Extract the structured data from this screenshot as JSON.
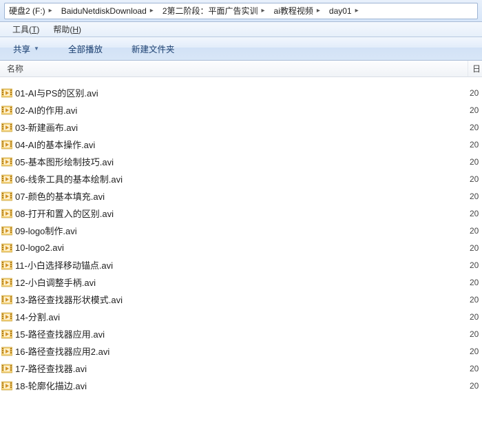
{
  "breadcrumb": [
    {
      "label": "硬盘2 (F:)"
    },
    {
      "label": "BaiduNetdiskDownload"
    },
    {
      "label": "2第二阶段：平面广告实训"
    },
    {
      "label": "ai教程视频"
    },
    {
      "label": "day01"
    }
  ],
  "menubar": {
    "tools": "工具",
    "tools_key": "T",
    "help": "帮助",
    "help_key": "H"
  },
  "cmdbar": {
    "share": "共享",
    "play_all": "全部播放",
    "new_folder": "新建文件夹"
  },
  "columns": {
    "name": "名称",
    "date": "日"
  },
  "files": [
    {
      "name": "01-AI与PS的区别.avi",
      "date": "20"
    },
    {
      "name": "02-AI的作用.avi",
      "date": "20"
    },
    {
      "name": "03-新建画布.avi",
      "date": "20"
    },
    {
      "name": "04-AI的基本操作.avi",
      "date": "20"
    },
    {
      "name": "05-基本图形绘制技巧.avi",
      "date": "20"
    },
    {
      "name": "06-线条工具的基本绘制.avi",
      "date": "20"
    },
    {
      "name": "07-颜色的基本填充.avi",
      "date": "20"
    },
    {
      "name": "08-打开和置入的区别.avi",
      "date": "20"
    },
    {
      "name": "09-logo制作.avi",
      "date": "20"
    },
    {
      "name": "10-logo2.avi",
      "date": "20"
    },
    {
      "name": "11-小白选择移动锚点.avi",
      "date": "20"
    },
    {
      "name": "12-小白调整手柄.avi",
      "date": "20"
    },
    {
      "name": "13-路径查找器形状模式.avi",
      "date": "20"
    },
    {
      "name": "14-分割.avi",
      "date": "20"
    },
    {
      "name": "15-路径查找器应用.avi",
      "date": "20"
    },
    {
      "name": "16-路径查找器应用2.avi",
      "date": "20"
    },
    {
      "name": "17-路径查找器.avi",
      "date": "20"
    },
    {
      "name": "18-轮廓化描边.avi",
      "date": "20"
    }
  ]
}
